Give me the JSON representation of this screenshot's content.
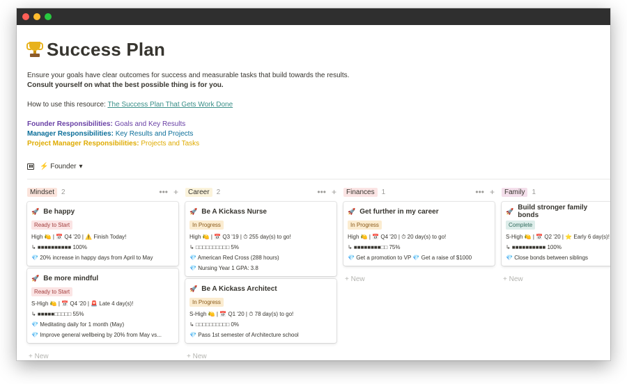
{
  "window": {
    "title_dots": [
      "close",
      "minimize",
      "maximize"
    ]
  },
  "page": {
    "icon": "trophy-icon",
    "title": "Success Plan",
    "desc1": "Ensure your goals have clear outcomes for success and measurable tasks that build towards the results.",
    "desc2": "Consult yourself on what the best possible thing is for you.",
    "how_label": "How to use this resource: ",
    "how_link": "The Success Plan That Gets Work Done",
    "founder_label": "Founder Responsibilities:",
    "founder_value": " Goals and Key Results",
    "manager_label": "Manager Responsibilities:",
    "manager_value": " Key Results and Projects",
    "pm_label": "Project Manager Responsibilities:",
    "pm_value": " Projects and Tasks"
  },
  "view": {
    "icon": "board-icon",
    "label": "⚡ Founder",
    "chevron": "▾"
  },
  "colors": {
    "mindset": "#fbe4dc",
    "career": "#fbf3db",
    "finances": "#fbe4e4",
    "family": "#f4dfeb"
  },
  "columns": [
    {
      "tag": "Mindset",
      "count": "2",
      "cards": [
        {
          "title": "Be happy",
          "status": "Ready to Start",
          "line1": "High 🍋 | 📅 Q4 '20 | ⚠️ Finish Today!",
          "line2": "↳ ■■■■■■■■■■ 100%",
          "goals": [
            "20% increase in happy days from April to May"
          ]
        },
        {
          "title": "Be more mindful",
          "status": "Ready to Start",
          "line1": "S-High 🍋 | 📅 Q4 '20 | 🚨 Late 4 day(s)!",
          "line2": "↳ ■■■■■□□□□□ 55%",
          "goals": [
            "Meditating daily for 1 month (May)",
            "Improve general wellbeing by 20% from May vs..."
          ]
        }
      ],
      "new": "+ New"
    },
    {
      "tag": "Career",
      "count": "2",
      "cards": [
        {
          "title": "Be A Kickass Nurse",
          "status": "In Progress",
          "line1": "High 🍋 | 📅 Q3 '19 | ⏱ 255 day(s) to go!",
          "line2": "↳ □□□□□□□□□□ 5%",
          "goals": [
            "American Red Cross (288 hours)",
            "Nursing Year 1 GPA: 3.8"
          ]
        },
        {
          "title": "Be A Kickass Architect",
          "status": "In Progress",
          "line1": "S-High 🍋 | 📅 Q1 '20 | ⏱ 78 day(s) to go!",
          "line2": "↳ □□□□□□□□□□ 0%",
          "goals": [
            "Pass 1st semester of Architecture school"
          ]
        }
      ],
      "new": "+ New"
    },
    {
      "tag": "Finances",
      "count": "1",
      "cards": [
        {
          "title": "Get further in my career",
          "status": "In Progress",
          "line1": "High 🍋 | 📅 Q4 '20 | ⏱ 20 day(s) to go!",
          "line2": "↳ ■■■■■■■■□□ 75%",
          "goals": [
            "Get a promotion to VP   💎 Get a raise of $1000"
          ]
        }
      ],
      "new": "+ New"
    },
    {
      "tag": "Family",
      "count": "1",
      "cards": [
        {
          "title": "Build stronger family bonds",
          "status": "Complete",
          "line1": "S-High 🍋 | 📅 Q2 '20 | ⭐ Early 6 day(s)!",
          "line2": "↳ ■■■■■■■■■■ 100%",
          "goals": [
            "Close bonds between siblings"
          ]
        }
      ],
      "new": "+ New"
    }
  ]
}
